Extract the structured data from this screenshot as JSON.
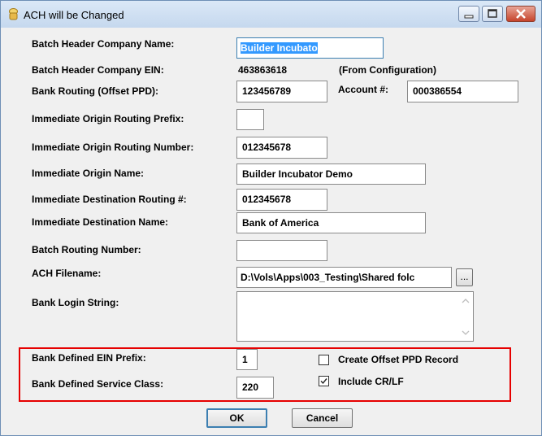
{
  "window": {
    "title": "ACH will be Changed"
  },
  "form": {
    "batch_header_company_name": {
      "label": "Batch Header Company Name:",
      "value": "Builder Incubato"
    },
    "batch_header_company_ein": {
      "label": "Batch Header Company EIN:",
      "value": "463863618",
      "note": "(From Configuration)"
    },
    "bank_routing": {
      "label": "Bank Routing (Offset PPD):",
      "value": "123456789"
    },
    "account": {
      "label": "Account #:",
      "value": "000386554"
    },
    "immediate_origin_routing_prefix": {
      "label": "Immediate Origin Routing Prefix:",
      "value": ""
    },
    "immediate_origin_routing_number": {
      "label": "Immediate Origin Routing Number:",
      "value": "012345678"
    },
    "immediate_origin_name": {
      "label": "Immediate Origin Name:",
      "value": "Builder Incubator Demo"
    },
    "immediate_destination_routing": {
      "label": "Immediate Destination Routing #:",
      "value": "012345678"
    },
    "immediate_destination_name": {
      "label": "Immediate Destination Name:",
      "value": "Bank of America"
    },
    "batch_routing_number": {
      "label": "Batch Routing Number:",
      "value": ""
    },
    "ach_filename": {
      "label": "ACH Filename:",
      "value": "D:\\Vols\\Apps\\003_Testing\\Shared folc",
      "browse": "..."
    },
    "bank_login_string": {
      "label": "Bank Login String:",
      "value": ""
    },
    "bank_defined_ein_prefix": {
      "label": "Bank Defined EIN Prefix:",
      "value": "1"
    },
    "bank_defined_service_class": {
      "label": "Bank Defined Service Class:",
      "value": "220"
    },
    "create_offset_ppd": {
      "label": "Create Offset PPD Record",
      "checked": false
    },
    "include_crlf": {
      "label": "Include CR/LF",
      "checked": true
    }
  },
  "buttons": {
    "ok": "OK",
    "cancel": "Cancel"
  },
  "colors": {
    "highlight_border": "#e60000",
    "selection": "#3399ff"
  }
}
